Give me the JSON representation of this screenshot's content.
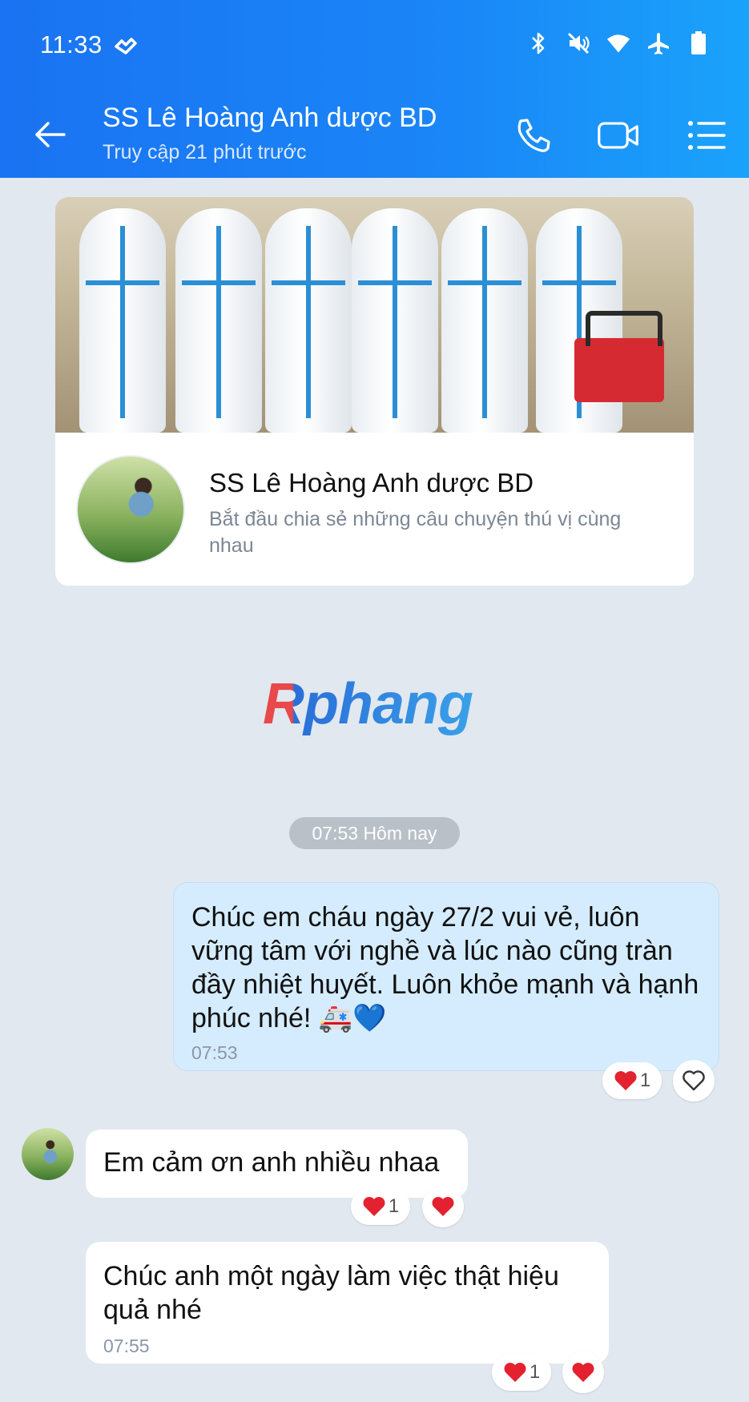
{
  "status_bar": {
    "time": "11:33",
    "icons": [
      "bluetooth-icon",
      "mute-icon",
      "wifi-icon",
      "airplane-icon",
      "battery-icon"
    ]
  },
  "header": {
    "title": "SS Lê Hoàng Anh dược BD",
    "subtitle": "Truy cập 21 phút trước",
    "buttons": [
      "back-arrow-icon",
      "phone-call-icon",
      "video-call-icon",
      "menu-list-icon"
    ]
  },
  "profile_card": {
    "name": "SS Lê Hoàng Anh dược BD",
    "description": "Bắt đầu chia sẻ những câu chuyện thú vị cùng nhau"
  },
  "watermark": "Rphang",
  "chat": {
    "date_separator": "07:53 Hôm nay",
    "messages": [
      {
        "direction": "outgoing",
        "text": "Chúc em cháu ngày 27/2 vui vẻ, luôn vững tâm với nghề và lúc nào cũng tràn đầy nhiệt huyết. Luôn khỏe mạnh và hạnh phúc nhé! 🚑💙",
        "time": "07:53",
        "reaction_count": "1"
      },
      {
        "direction": "incoming",
        "text": "Em cảm ơn anh nhiều nhaa",
        "time": "",
        "reaction_count": "1"
      },
      {
        "direction": "incoming",
        "text": "Chúc anh một ngày làm việc thật hiệu quả nhé",
        "time": "07:55",
        "reaction_count": "1"
      }
    ]
  },
  "colors": {
    "header_start": "#1a73f2",
    "header_end": "#1aa3fb",
    "chat_bg": "#e2e8f0",
    "outgoing_bubble": "#d4ecfd",
    "heart": "#e3212f"
  }
}
